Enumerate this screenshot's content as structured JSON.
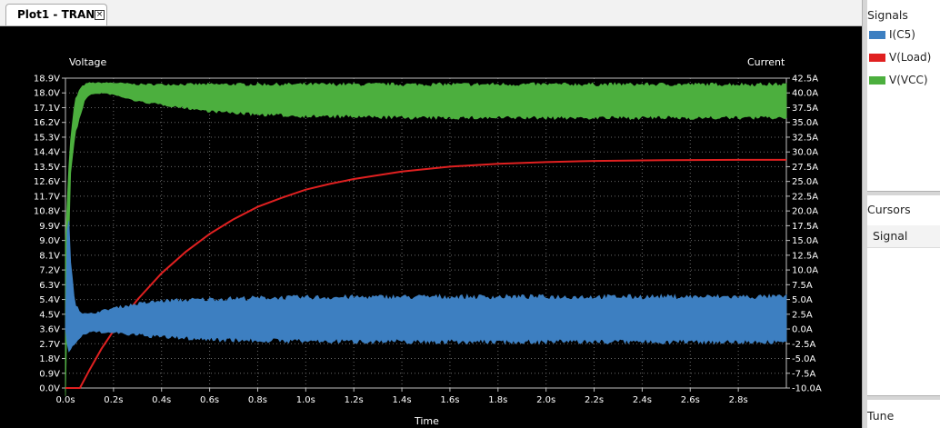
{
  "tab": {
    "label": "Plot1 - TRAN",
    "close_glyph": "×"
  },
  "side": {
    "signals_title": "Signals",
    "signals": [
      {
        "label": "I(C5)",
        "color": "#3d7fc1"
      },
      {
        "label": "V(Load)",
        "color": "#e02020"
      },
      {
        "label": "V(VCC)",
        "color": "#4caf3e"
      }
    ],
    "cursors_title": "Cursors",
    "cursors_column": "Signal",
    "tune_title": "Tune"
  },
  "chart_data": {
    "type": "line",
    "left_axis_title": "Voltage",
    "right_axis_title": "Current",
    "xlabel": "Time",
    "xlim": [
      0,
      3.0
    ],
    "x_ticks": [
      "0.0s",
      "0.2s",
      "0.4s",
      "0.6s",
      "0.8s",
      "1.0s",
      "1.2s",
      "1.4s",
      "1.6s",
      "1.8s",
      "2.0s",
      "2.2s",
      "2.4s",
      "2.6s",
      "2.8s"
    ],
    "ylim_left": [
      0,
      18.9
    ],
    "y_ticks_left": [
      "0.0V",
      "0.9V",
      "1.8V",
      "2.7V",
      "3.6V",
      "4.5V",
      "5.4V",
      "6.3V",
      "7.2V",
      "8.1V",
      "9.0V",
      "9.9V",
      "10.8V",
      "11.7V",
      "12.6V",
      "13.5V",
      "14.4V",
      "15.3V",
      "16.2V",
      "17.1V",
      "18.0V",
      "18.9V"
    ],
    "ylim_right": [
      -10,
      42.5
    ],
    "y_ticks_right": [
      "-10.0A",
      "-7.5A",
      "-5.0A",
      "-2.5A",
      "0.0A",
      "2.5A",
      "5.0A",
      "7.5A",
      "10.0A",
      "12.5A",
      "15.0A",
      "17.5A",
      "20.0A",
      "22.5A",
      "25.0A",
      "27.5A",
      "30.0A",
      "32.5A",
      "35.0A",
      "37.5A",
      "40.0A",
      "42.5A"
    ],
    "grid": true,
    "series": [
      {
        "name": "V(VCC)",
        "color": "#4caf3e",
        "axis": "left",
        "kind": "band",
        "x": [
          0.0,
          0.02,
          0.04,
          0.06,
          0.08,
          0.1,
          0.15,
          0.2,
          0.3,
          0.4,
          0.5,
          0.6,
          0.8,
          1.0,
          1.5,
          2.0,
          2.5,
          3.0
        ],
        "upper": [
          9.5,
          15.0,
          17.5,
          18.2,
          18.5,
          18.6,
          18.6,
          18.6,
          18.5,
          18.5,
          18.5,
          18.5,
          18.5,
          18.5,
          18.5,
          18.5,
          18.5,
          18.5
        ],
        "lower": [
          0.0,
          13.0,
          15.5,
          16.5,
          17.6,
          17.9,
          18.0,
          17.9,
          17.5,
          17.3,
          17.1,
          16.9,
          16.7,
          16.6,
          16.5,
          16.5,
          16.5,
          16.5
        ]
      },
      {
        "name": "V(Load)",
        "color": "#e02020",
        "axis": "left",
        "kind": "line",
        "x": [
          0.0,
          0.06,
          0.1,
          0.15,
          0.2,
          0.3,
          0.4,
          0.5,
          0.6,
          0.7,
          0.8,
          0.9,
          1.0,
          1.1,
          1.2,
          1.4,
          1.6,
          1.8,
          2.0,
          2.2,
          2.5,
          2.8,
          3.0
        ],
        "y": [
          0.0,
          0.0,
          1.1,
          2.4,
          3.5,
          5.4,
          7.0,
          8.3,
          9.4,
          10.3,
          11.05,
          11.6,
          12.1,
          12.45,
          12.75,
          13.2,
          13.5,
          13.68,
          13.78,
          13.85,
          13.9,
          13.92,
          13.92
        ]
      },
      {
        "name": "I(C5)",
        "color": "#3d7fc1",
        "axis": "right",
        "kind": "band",
        "x": [
          0.0,
          0.01,
          0.02,
          0.04,
          0.06,
          0.08,
          0.1,
          0.15,
          0.2,
          0.3,
          0.4,
          0.6,
          0.8,
          1.0,
          1.5,
          2.0,
          2.5,
          3.0
        ],
        "upper": [
          0.0,
          22.0,
          12.0,
          4.5,
          3.0,
          2.5,
          2.5,
          3.0,
          3.5,
          4.2,
          4.7,
          5.0,
          5.2,
          5.3,
          5.4,
          5.4,
          5.4,
          5.4
        ],
        "lower": [
          0.0,
          -3.0,
          -3.0,
          -2.5,
          -1.5,
          -0.8,
          -0.5,
          -0.5,
          -0.6,
          -1.0,
          -1.3,
          -1.7,
          -1.9,
          -2.0,
          -2.1,
          -2.1,
          -2.1,
          -2.1
        ]
      }
    ]
  }
}
